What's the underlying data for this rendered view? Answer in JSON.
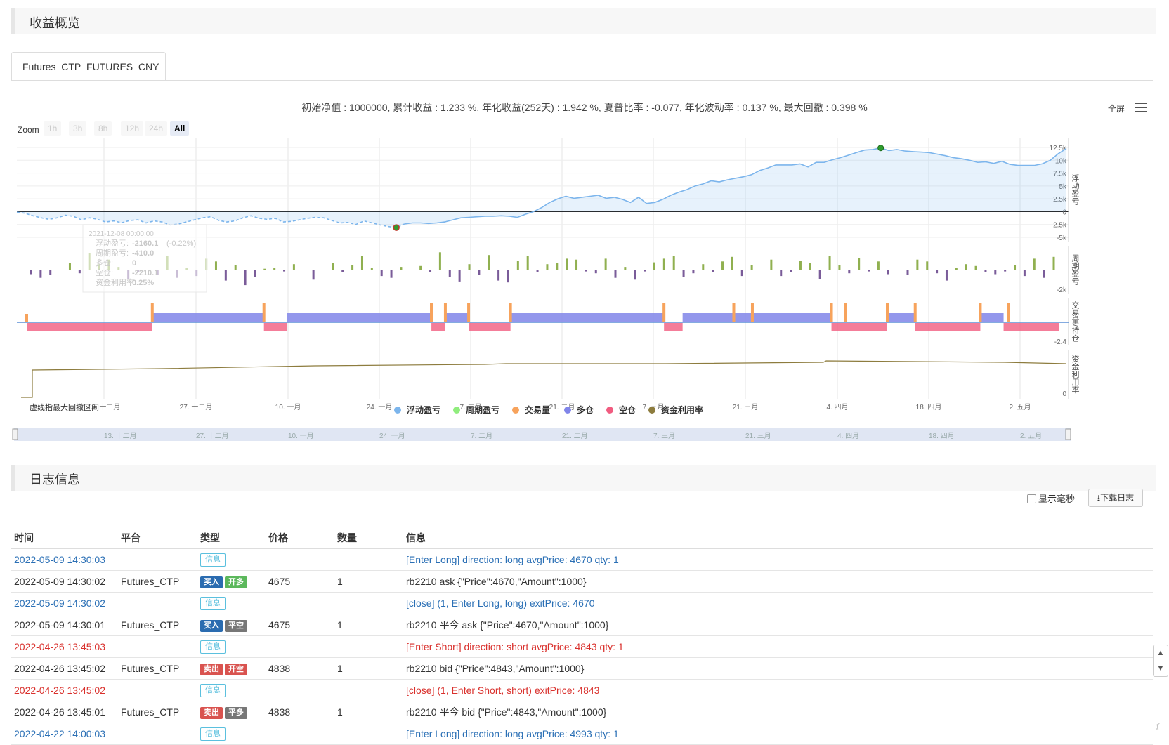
{
  "overview": {
    "title": "收益概览"
  },
  "tab": {
    "label": "Futures_CTP_FUTURES_CNY"
  },
  "summary": "初始净值 : 1000000, 累计收益 : 1.233 %, 年化收益(252天) : 1.942 %, 夏普比率 : -0.077, 年化波动率 : 0.137 %, 最大回撤 : 0.398 %",
  "toolbar": {
    "fullscreen": "全屏",
    "menu_icon": "hamburger-menu-icon"
  },
  "zoom": {
    "label": "Zoom",
    "options": [
      "1h",
      "3h",
      "8h",
      "12h",
      "24h",
      "All"
    ],
    "selected": "All"
  },
  "chart_data": {
    "type": "line",
    "x_ticks": [
      "13. 十二月",
      "27. 十二月",
      "10. 一月",
      "24. 一月",
      "7. 二月",
      "21. 二月",
      "7. 三月",
      "21. 三月",
      "4. 四月",
      "18. 四月",
      "2. 五月"
    ],
    "navigator_ticks": [
      "13. 十二月",
      "27. 十二月",
      "10. 一月",
      "24. 一月",
      "7. 二月",
      "21. 二月",
      "7. 三月",
      "21. 三月",
      "4. 四月",
      "18. 四月",
      "2. 五月"
    ],
    "panes": [
      {
        "name": "浮动盈亏",
        "ticks": [
          "12.5k",
          "10k",
          "7.5k",
          "5k",
          "2.5k",
          "0",
          "-2.5k",
          "-5k"
        ],
        "ylim": [
          -5000,
          12500
        ]
      },
      {
        "name": "周期盈亏",
        "ticks": [
          "-2k"
        ]
      },
      {
        "name": "交易量/持仓",
        "ticks": [
          "-2.4"
        ]
      },
      {
        "name": "资金利用率",
        "ticks": [
          "0"
        ]
      }
    ],
    "floating_pnl": [
      -100,
      -300,
      -800,
      -1200,
      -1500,
      -1200,
      -700,
      -900,
      -1600,
      -1200,
      -1500,
      -2000,
      -1800,
      -2160,
      -1700,
      -1600,
      -2200,
      -1800,
      -2000,
      -2600,
      -2400,
      -2000,
      -1600,
      -1200,
      -1000,
      -1700,
      -2000,
      -1800,
      -1200,
      -800,
      -1300,
      -1500,
      -1300,
      -2000,
      -1900,
      -1600,
      -1300,
      -1100,
      -1200,
      -1700,
      -2200,
      -2100,
      -2500,
      -1800,
      -2200,
      -2600,
      -2900,
      -3100,
      -2400,
      -2200,
      -2200,
      -2300,
      -2200,
      -2000,
      -1600,
      -1200,
      -1100,
      -1000,
      -900,
      -900,
      -800,
      -900,
      -1100,
      -500,
      0,
      800,
      1800,
      2500,
      3000,
      2600,
      2800,
      3000,
      3200,
      2600,
      2800,
      2400,
      1800,
      2800,
      1600,
      1800,
      2400,
      3200,
      3800,
      4300,
      5000,
      5400,
      6000,
      5800,
      6200,
      6500,
      6800,
      7200,
      8000,
      8500,
      9100,
      9100,
      9100,
      9300,
      8700,
      9600,
      9600,
      10100,
      10500,
      11000,
      11500,
      12000,
      12100,
      12400,
      11900,
      12100,
      11800,
      11700,
      11600,
      11500,
      11200,
      10900,
      10500,
      10300,
      10000,
      9600,
      9700,
      9400,
      9800,
      9200,
      9000,
      9000,
      9000,
      9300,
      10000,
      11300,
      12300
    ],
    "period_pnl": [
      -500,
      -900,
      -600,
      0,
      700,
      -400,
      1800,
      600,
      1100,
      300,
      -1000,
      -300,
      0,
      -600,
      1500,
      -900,
      200,
      -700,
      1200,
      900,
      -1200,
      500,
      -1700,
      -800,
      100,
      200,
      -200,
      600,
      0,
      -1100,
      0,
      700,
      -300,
      500,
      1500,
      200,
      -700,
      -900,
      300,
      0,
      400,
      -300,
      1900,
      -800,
      -1300,
      600,
      -600,
      1600,
      -1200,
      -1400,
      1000,
      1500,
      -300,
      600,
      700,
      1200,
      1100,
      -200,
      -400,
      1200,
      -900,
      300,
      -1100,
      -200,
      800,
      1200,
      1500,
      -800,
      -400,
      600,
      -300,
      900,
      1400,
      -700,
      500,
      0,
      1100,
      -700,
      -300,
      1000,
      700,
      -1000,
      1500,
      500,
      -400,
      1300,
      -200,
      900,
      -500,
      0,
      -600,
      1100,
      900,
      -400,
      -1200,
      200,
      600,
      400,
      -300,
      -500,
      -200,
      500,
      -700,
      1200,
      -900,
      1400
    ],
    "volume_markers": [
      0,
      27,
      51,
      87,
      87,
      90,
      95,
      104,
      137,
      152,
      156,
      173,
      176,
      185,
      191,
      205,
      211
    ],
    "long_positions": [
      [
        27,
        51
      ],
      [
        56,
        87
      ],
      [
        90,
        95
      ],
      [
        104,
        137
      ],
      [
        141,
        173
      ],
      [
        185,
        191
      ],
      [
        205,
        210
      ]
    ],
    "short_positions": [
      [
        0,
        27
      ],
      [
        51,
        56
      ],
      [
        87,
        90
      ],
      [
        95,
        104
      ],
      [
        137,
        141
      ],
      [
        173,
        185
      ],
      [
        191,
        205
      ],
      [
        210,
        222
      ]
    ],
    "utilization": [
      0,
      0.2,
      0.25,
      0.22,
      0.25,
      0.24,
      0.26,
      0.27,
      0.28,
      0.27,
      0.29,
      0.3,
      0.29,
      0.3,
      0.29,
      0.28,
      0.27,
      0.26,
      0.25,
      0.29,
      0.31,
      0.29
    ],
    "tooltip": {
      "date": "2021-12-08 00:00:00",
      "floating_label": "浮动盈亏:",
      "floating_value": "-2160.1",
      "floating_pct": "(-0.22%)",
      "period_label": "周期盈亏:",
      "period_value": "-410.0",
      "long_label": "多仓:",
      "long_value": "0",
      "short_label": "空仓:",
      "short_value": "-2210.1",
      "util_label": "资金利用率:",
      "util_value": "0.25%"
    },
    "legend": [
      {
        "name": "浮动盈亏",
        "color": "#7cb5ec"
      },
      {
        "name": "周期盈亏",
        "color": "#90ed7d"
      },
      {
        "name": "交易量",
        "color": "#f7a35c"
      },
      {
        "name": "多仓",
        "color": "#8085e9"
      },
      {
        "name": "空仓",
        "color": "#f15c80"
      },
      {
        "name": "资金利用率",
        "color": "#8d7c3e"
      }
    ],
    "dashed_note": "虚线指最大回撤区间"
  },
  "log": {
    "title": "日志信息",
    "show_ms": "显示毫秒",
    "download": "下载日志",
    "headers": [
      "时间",
      "平台",
      "类型",
      "价格",
      "数量",
      "信息"
    ],
    "rows": [
      {
        "time": "2022-05-09 14:30:03",
        "platform": "",
        "badges": [
          {
            "text": "信息",
            "cls": "b-info"
          }
        ],
        "price": "",
        "qty": "",
        "info": "[Enter Long] direction: long avgPrice: 4670 qty: 1",
        "color": "blue"
      },
      {
        "time": "2022-05-09 14:30:02",
        "platform": "Futures_CTP",
        "badges": [
          {
            "text": "买入",
            "cls": "b-buy"
          },
          {
            "text": "开多",
            "cls": "b-open"
          }
        ],
        "price": "4675",
        "qty": "1",
        "info": "rb2210 ask {\"Price\":4670,\"Amount\":1000}",
        "color": ""
      },
      {
        "time": "2022-05-09 14:30:02",
        "platform": "",
        "badges": [
          {
            "text": "信息",
            "cls": "b-info"
          }
        ],
        "price": "",
        "qty": "",
        "info": "[close] (1, Enter Long, long) exitPrice: 4670",
        "color": "blue"
      },
      {
        "time": "2022-05-09 14:30:01",
        "platform": "Futures_CTP",
        "badges": [
          {
            "text": "买入",
            "cls": "b-buy"
          },
          {
            "text": "平空",
            "cls": "b-close"
          }
        ],
        "price": "4675",
        "qty": "1",
        "info": "rb2210 平今 ask {\"Price\":4670,\"Amount\":1000}",
        "color": ""
      },
      {
        "time": "2022-04-26 13:45:03",
        "platform": "",
        "badges": [
          {
            "text": "信息",
            "cls": "b-info"
          }
        ],
        "price": "",
        "qty": "",
        "info": "[Enter Short] direction: short avgPrice: 4843 qty: 1",
        "color": "red"
      },
      {
        "time": "2022-04-26 13:45:02",
        "platform": "Futures_CTP",
        "badges": [
          {
            "text": "卖出",
            "cls": "b-sell"
          },
          {
            "text": "开空",
            "cls": "b-sell"
          }
        ],
        "price": "4838",
        "qty": "1",
        "info": "rb2210 bid {\"Price\":4843,\"Amount\":1000}",
        "color": ""
      },
      {
        "time": "2022-04-26 13:45:02",
        "platform": "",
        "badges": [
          {
            "text": "信息",
            "cls": "b-info"
          }
        ],
        "price": "",
        "qty": "",
        "info": "[close] (1, Enter Short, short) exitPrice: 4843",
        "color": "red"
      },
      {
        "time": "2022-04-26 13:45:01",
        "platform": "Futures_CTP",
        "badges": [
          {
            "text": "卖出",
            "cls": "b-sell"
          },
          {
            "text": "平多",
            "cls": "b-close"
          }
        ],
        "price": "4838",
        "qty": "1",
        "info": "rb2210 平今 bid {\"Price\":4843,\"Amount\":1000}",
        "color": ""
      },
      {
        "time": "2022-04-22 14:00:03",
        "platform": "",
        "badges": [
          {
            "text": "信息",
            "cls": "b-info"
          }
        ],
        "price": "",
        "qty": "",
        "info": "[Enter Long] direction: long avgPrice: 4993 qty: 1",
        "color": "blue"
      }
    ]
  }
}
